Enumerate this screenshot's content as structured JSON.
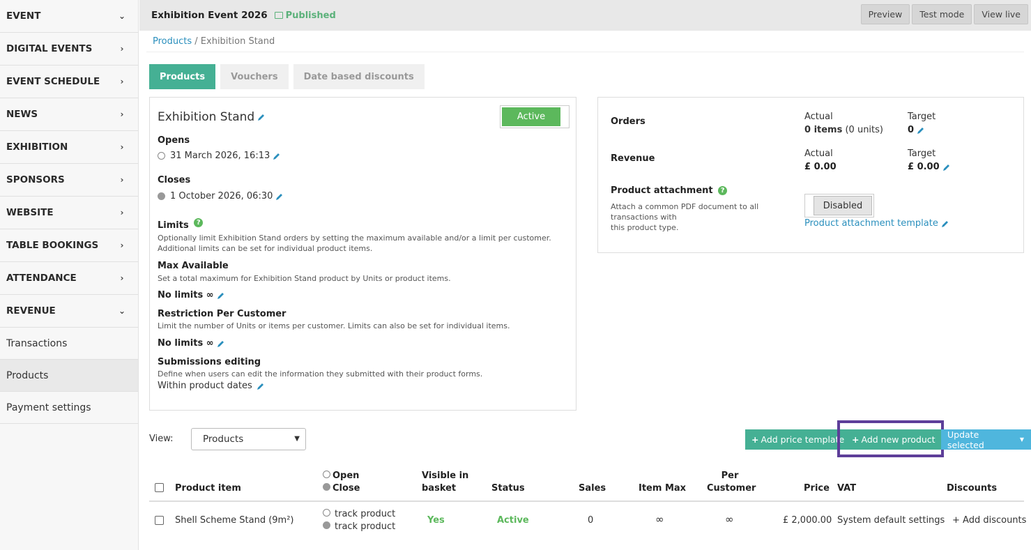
{
  "sidebar": {
    "items": [
      {
        "label": "EVENT",
        "chevron": "down"
      },
      {
        "label": "DIGITAL EVENTS",
        "chevron": "right"
      },
      {
        "label": "EVENT SCHEDULE",
        "chevron": "right"
      },
      {
        "label": "NEWS",
        "chevron": "right"
      },
      {
        "label": "EXHIBITION",
        "chevron": "right"
      },
      {
        "label": "SPONSORS",
        "chevron": "right"
      },
      {
        "label": "WEBSITE",
        "chevron": "right"
      },
      {
        "label": "TABLE BOOKINGS",
        "chevron": "right"
      },
      {
        "label": "ATTENDANCE",
        "chevron": "right"
      },
      {
        "label": "REVENUE",
        "chevron": "down"
      }
    ],
    "sub_items": [
      "Transactions",
      "Products",
      "Payment settings"
    ],
    "active_sub": "Products"
  },
  "header": {
    "title": "Exhibition Event 2026",
    "status": "Published",
    "buttons": [
      "Preview",
      "Test mode",
      "View live"
    ]
  },
  "breadcrumb": {
    "link": "Products",
    "separator": " / ",
    "current": "Exhibition Stand"
  },
  "tabs": [
    {
      "label": "Products",
      "active": true
    },
    {
      "label": "Vouchers",
      "active": false
    },
    {
      "label": "Date based discounts",
      "active": false
    }
  ],
  "product": {
    "title": "Exhibition Stand",
    "toggle": "Active",
    "opens_label": "Opens",
    "opens_value": "31 March 2026, 16:13",
    "closes_label": "Closes",
    "closes_value": "1 October 2026, 06:30",
    "limits_label": "Limits",
    "limits_help": "Optionally limit Exhibition Stand orders by setting the maximum available and/or a limit per customer. Additional limits can be set for individual product items.",
    "max_label": "Max Available",
    "max_help": "Set a total maximum for Exhibition Stand product by Units or product items.",
    "max_value": "No limits ∞",
    "restriction_label": "Restriction Per Customer",
    "restriction_help": "Limit the number of Units or items per customer. Limits can also be set for individual items.",
    "restriction_value": "No limits ∞",
    "submissions_label": "Submissions editing",
    "submissions_help": "Define when users can edit the information they submitted with their product forms.",
    "submissions_value": "Within product dates"
  },
  "stats": {
    "orders_label": "Orders",
    "revenue_label": "Revenue",
    "actual_label": "Actual",
    "target_label": "Target",
    "orders_actual_bold": "0 items",
    "orders_actual_rest": " (0 units)",
    "orders_target": "0",
    "revenue_actual": "£ 0.00",
    "revenue_target": "£ 0.00",
    "attachment_label": "Product attachment",
    "attachment_help_1": "Attach a common PDF document to all",
    "attachment_help_2": "transactions with",
    "attachment_help_3": "this product type.",
    "attachment_toggle": "Disabled",
    "attachment_link": "Product attachment template"
  },
  "toolbar": {
    "view_label": "View:",
    "view_value": "Products",
    "add_price_template": "Add price template",
    "add_new_product": "Add new product",
    "update_selected": "Update selected"
  },
  "table": {
    "headers": {
      "product_item": "Product item",
      "open": "Open",
      "close": "Close",
      "visible_1": "Visible in",
      "visible_2": "basket",
      "status": "Status",
      "sales": "Sales",
      "item_max": "Item Max",
      "per_1": "Per",
      "per_2": "Customer",
      "price": "Price",
      "vat": "VAT",
      "discounts": "Discounts"
    },
    "rows": [
      {
        "name": "Shell Scheme Stand (9m²)",
        "open": "track product",
        "close": "track product",
        "visible": "Yes",
        "status": "Active",
        "sales": "0",
        "item_max": "∞",
        "per_customer": "∞",
        "price": "£ 2,000.00",
        "vat": "System default settings",
        "discounts": "+ Add discounts"
      }
    ]
  },
  "colors": {
    "accent": "#45b094",
    "active_green": "#5cb85c",
    "link": "#2a8fbd",
    "highlight": "#5d3e99",
    "info": "#4fb6dd"
  }
}
